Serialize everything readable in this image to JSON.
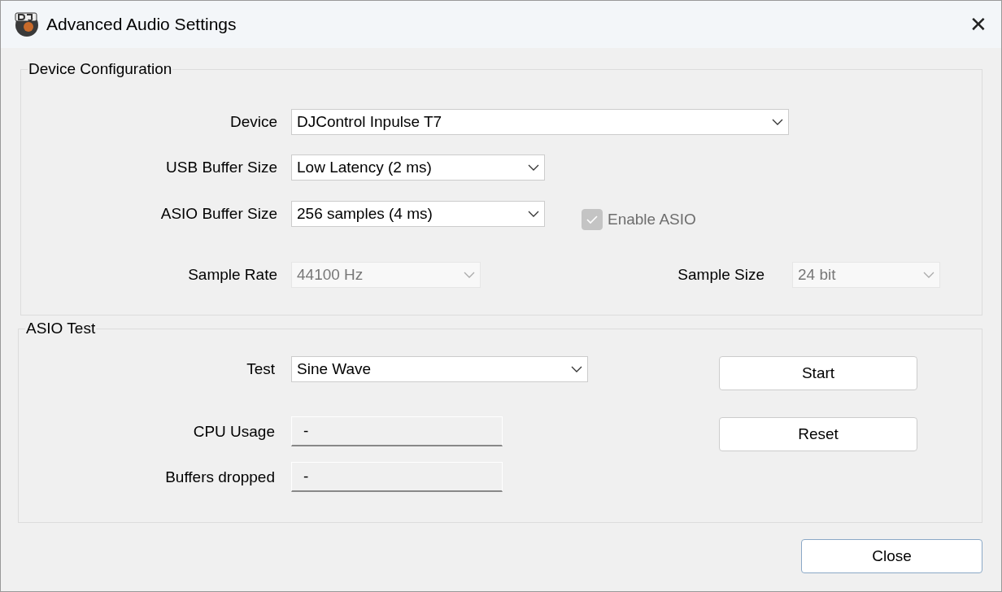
{
  "window": {
    "title": "Advanced Audio Settings",
    "close_glyph": "✕"
  },
  "device_configuration": {
    "title": "Device Configuration",
    "device": {
      "label": "Device",
      "value": "DJControl Inpulse T7",
      "disabled": false
    },
    "usb_buffer_size": {
      "label": "USB Buffer Size",
      "value": "Low Latency (2 ms)",
      "disabled": false
    },
    "asio_buffer_size": {
      "label": "ASIO Buffer Size",
      "value": "256 samples (4 ms)",
      "disabled": false
    },
    "enable_asio": {
      "label": "Enable ASIO",
      "checked": true,
      "disabled": true
    },
    "sample_rate": {
      "label": "Sample Rate",
      "value": "44100 Hz",
      "disabled": true
    },
    "sample_size": {
      "label": "Sample Size",
      "value": "24 bit",
      "disabled": true
    }
  },
  "asio_test": {
    "title": "ASIO Test",
    "test": {
      "label": "Test",
      "value": "Sine Wave",
      "disabled": false
    },
    "cpu_usage": {
      "label": "CPU Usage",
      "value": "-"
    },
    "buffers_dropped": {
      "label": "Buffers dropped",
      "value": "-"
    },
    "buttons": [
      "Start",
      "Reset"
    ]
  },
  "buttons": [
    "Close"
  ]
}
